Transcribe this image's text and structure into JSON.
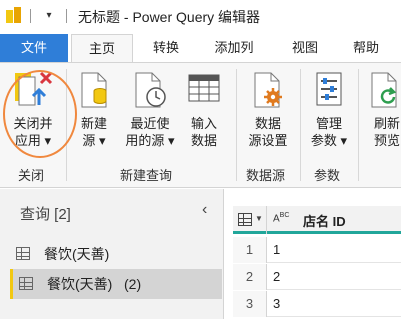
{
  "window": {
    "qat_dropdown": "▾",
    "title": "无标题 - Power Query 编辑器"
  },
  "tabs": [
    {
      "label": "文件"
    },
    {
      "label": "主页"
    },
    {
      "label": "转换"
    },
    {
      "label": "添加列"
    },
    {
      "label": "视图"
    },
    {
      "label": "帮助"
    }
  ],
  "ribbon": {
    "close_apply": {
      "line1": "关闭并",
      "line2": "应用 ▾"
    },
    "new_source": {
      "line1": "新建",
      "line2": "源 ▾"
    },
    "recent_sources": {
      "line1": "最近使",
      "line2": "用的源 ▾"
    },
    "enter_data": {
      "line1": "输入",
      "line2": "数据"
    },
    "source_settings": {
      "line1": "数据",
      "line2": "源设置"
    },
    "manage_params": {
      "line1": "管理",
      "line2": "参数 ▾"
    },
    "refresh_preview": {
      "line1": "刷新",
      "line2": "预览"
    },
    "groups": {
      "close": "关闭",
      "new_query": "新建查询",
      "data_sources": "数据源",
      "parameters": "参数"
    }
  },
  "queries_pane": {
    "title": "查询 [2]",
    "collapse": "‹",
    "items": [
      {
        "label": "餐饮(天善)"
      },
      {
        "label": "餐饮(天善)   (2)"
      }
    ]
  },
  "grid": {
    "type_label": "ABC",
    "column": "店名 ID",
    "rows": [
      {
        "n": "1",
        "v": "1"
      },
      {
        "n": "2",
        "v": "2"
      },
      {
        "n": "3",
        "v": "3"
      }
    ]
  },
  "colors": {
    "file_tab": "#2f7ed8",
    "accent_yellow": "#f2c811",
    "column_underline": "#21a69a",
    "highlight_ring": "#f0883e"
  }
}
